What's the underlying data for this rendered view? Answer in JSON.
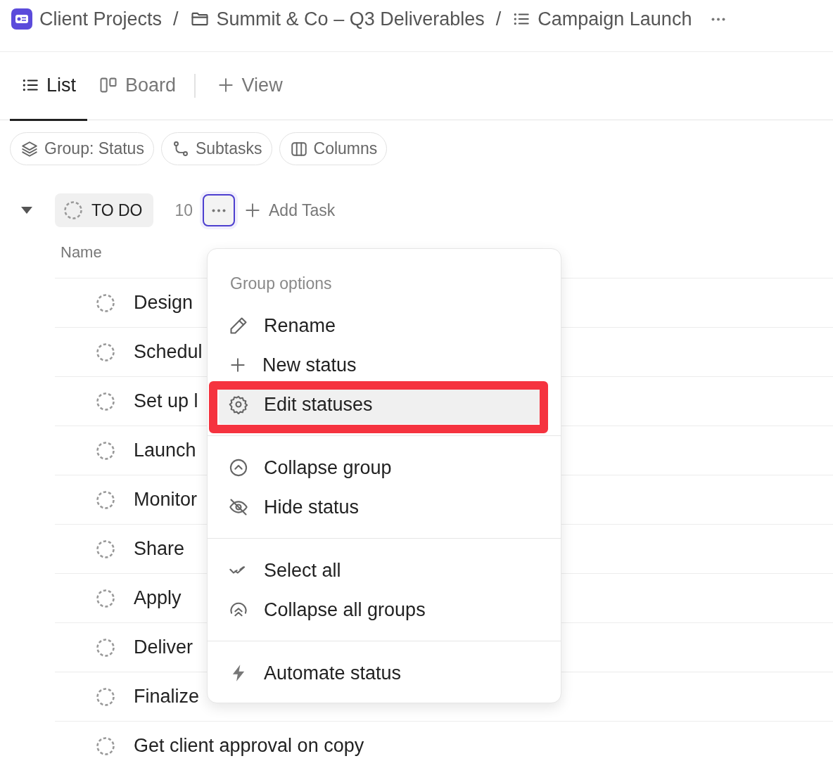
{
  "breadcrumb": [
    {
      "kind": "space",
      "label": "Client Projects"
    },
    {
      "kind": "separator",
      "label": "/"
    },
    {
      "kind": "folder",
      "label": "Summit & Co – Q3 Deliverables"
    },
    {
      "kind": "separator",
      "label": "/"
    },
    {
      "kind": "list",
      "label": "Campaign Launch"
    }
  ],
  "view_tabs": [
    {
      "kind": "list",
      "label": "List",
      "selected": true
    },
    {
      "kind": "board",
      "label": "Board",
      "selected": false
    }
  ],
  "add_view": "View",
  "toolbar": [
    {
      "kind": "layers",
      "label": "Group: Status"
    },
    {
      "kind": "subtasks",
      "label": "Subtasks"
    },
    {
      "kind": "columns",
      "label": "Columns"
    }
  ],
  "group": {
    "status": "TO DO",
    "count": "10",
    "expanded": true,
    "menu_open": true,
    "add_task": "Add Task"
  },
  "table": {
    "columns": [
      "Name"
    ],
    "rows": [
      {
        "name": "Design"
      },
      {
        "name": "Schedul"
      },
      {
        "name": "Set up l"
      },
      {
        "name": "Launch"
      },
      {
        "name": "Monitor"
      },
      {
        "name": "Share"
      },
      {
        "name": "Apply"
      },
      {
        "name": "Deliver"
      },
      {
        "name": "Finalize"
      },
      {
        "name": "Get client approval on copy"
      }
    ]
  },
  "menu": {
    "title": "Group options",
    "sections": [
      [
        {
          "kind": "pencil",
          "label": "Rename",
          "highlighted": false,
          "callout": false
        },
        {
          "kind": "plus",
          "label": "New status",
          "highlighted": false,
          "callout": false
        },
        {
          "kind": "gear",
          "label": "Edit statuses",
          "highlighted": true,
          "callout": true
        }
      ],
      [
        {
          "kind": "collapse",
          "label": "Collapse group",
          "highlighted": false,
          "callout": false
        },
        {
          "kind": "hide",
          "label": "Hide status",
          "highlighted": false,
          "callout": false
        }
      ],
      [
        {
          "kind": "select",
          "label": "Select all",
          "highlighted": false,
          "callout": false
        },
        {
          "kind": "collapse-all",
          "label": "Collapse all groups",
          "highlighted": false,
          "callout": false
        }
      ],
      [
        {
          "kind": "bolt",
          "label": "Automate status",
          "highlighted": false,
          "callout": false
        }
      ]
    ]
  }
}
